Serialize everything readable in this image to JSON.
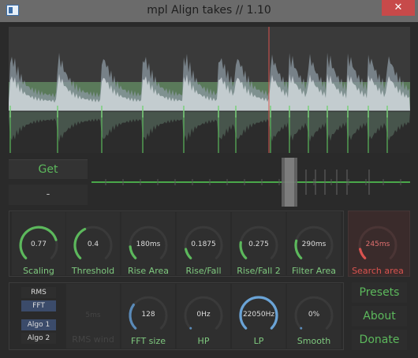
{
  "window": {
    "title": "mpl Align takes // 1.10",
    "close_glyph": "✕",
    "accent": "#5cb85c",
    "cursor_color": "#d9534f"
  },
  "left_buttons": {
    "get_label": "Get",
    "dash_label": "-"
  },
  "knobs_row1": [
    {
      "value": "0.77",
      "label": "Scaling",
      "level": 0.77,
      "active": true
    },
    {
      "value": "0.4",
      "label": "Threshold",
      "level": 0.4,
      "active": true
    },
    {
      "value": "180ms",
      "label": "Rise Area",
      "level": 0.15,
      "active": false
    },
    {
      "value": "0.1875",
      "label": "Rise/Fall",
      "level": 0.12,
      "active": false
    },
    {
      "value": "0.275",
      "label": "Rise/Fall 2",
      "level": 0.2,
      "active": false
    },
    {
      "value": "290ms",
      "label": "Filter Area",
      "level": 0.22,
      "active": false
    }
  ],
  "search_area": {
    "value": "245ms",
    "label": "Search area",
    "level": 0.12
  },
  "mode_buttons": {
    "rms": "RMS",
    "fft": "FFT",
    "algo1": "Algo 1",
    "algo2": "Algo 2"
  },
  "rms_wind": {
    "value": "5ms",
    "label": "RMS wind"
  },
  "knobs_row2": [
    {
      "value": "128",
      "label": "FFT size",
      "level": 0.3
    },
    {
      "value": "0Hz",
      "label": "HP",
      "level": 0.0
    },
    {
      "value": "22050Hz",
      "label": "LP",
      "level": 1.0
    },
    {
      "value": "0%",
      "label": "Smooth",
      "level": 0.0
    }
  ],
  "right_buttons": {
    "presets": "Presets",
    "about": "About",
    "donate": "Donate"
  }
}
